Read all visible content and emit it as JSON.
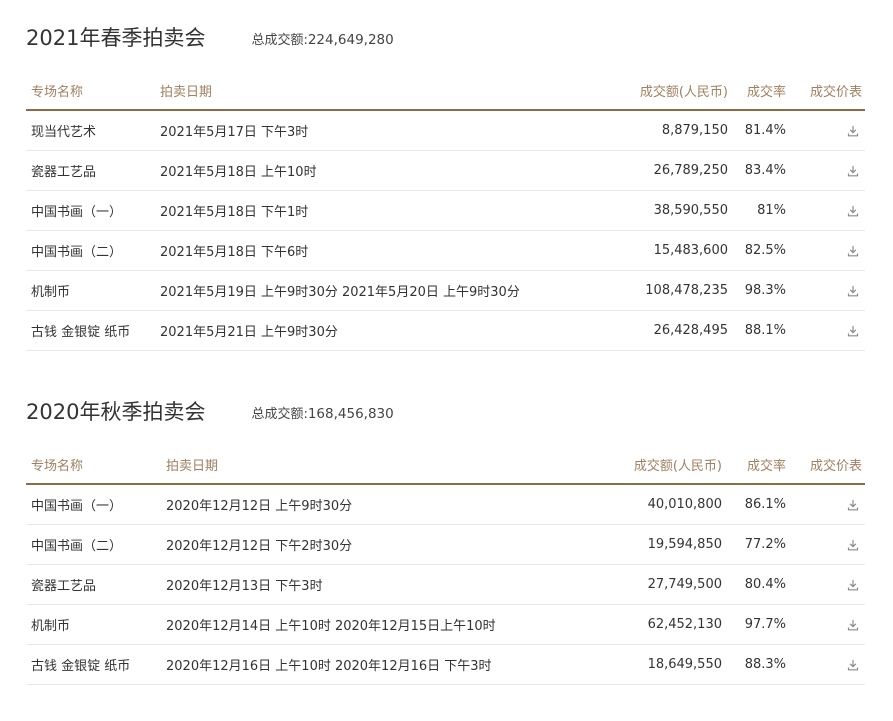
{
  "sections": [
    {
      "title": "2021年春季拍卖会",
      "total_label": "总成交额:",
      "total_value": "224,649,280",
      "headers": {
        "name": "专场名称",
        "date": "拍卖日期",
        "amount": "成交额(人民币)",
        "rate": "成交率",
        "price_list": "成交价表"
      },
      "rows": [
        {
          "name": "现当代艺术",
          "date": "2021年5月17日 下午3时",
          "amount": "8,879,150",
          "rate": "81.4%",
          "icon": "download-icon"
        },
        {
          "name": "瓷器工艺品",
          "date": "2021年5月18日 上午10时",
          "amount": "26,789,250",
          "rate": "83.4%",
          "icon": "download-icon"
        },
        {
          "name": "中国书画（一）",
          "date": "2021年5月18日 下午1时",
          "amount": "38,590,550",
          "rate": "81%",
          "icon": "download-icon"
        },
        {
          "name": "中国书画（二）",
          "date": "2021年5月18日 下午6时",
          "amount": "15,483,600",
          "rate": "82.5%",
          "icon": "download-icon"
        },
        {
          "name": "机制币",
          "date": "2021年5月19日 上午9时30分 2021年5月20日 上午9时30分",
          "amount": "108,478,235",
          "rate": "98.3%",
          "icon": "download-icon"
        },
        {
          "name": "古钱 金银锭 纸币",
          "date": "2021年5月21日 上午9时30分",
          "amount": "26,428,495",
          "rate": "88.1%",
          "icon": "download-icon"
        }
      ]
    },
    {
      "title": "2020年秋季拍卖会",
      "total_label": "总成交额:",
      "total_value": "168,456,830",
      "headers": {
        "name": "专场名称",
        "date": "拍卖日期",
        "amount": "成交额(人民币)",
        "rate": "成交率",
        "price_list": "成交价表"
      },
      "rows": [
        {
          "name": "中国书画（一）",
          "date": "2020年12月12日 上午9时30分",
          "amount": "40,010,800",
          "rate": "86.1%",
          "icon": "download-icon"
        },
        {
          "name": "中国书画（二）",
          "date": "2020年12月12日 下午2时30分",
          "amount": "19,594,850",
          "rate": "77.2%",
          "icon": "download-icon"
        },
        {
          "name": "瓷器工艺品",
          "date": "2020年12月13日 下午3时",
          "amount": "27,749,500",
          "rate": "80.4%",
          "icon": "download-icon"
        },
        {
          "name": "机制币",
          "date": "2020年12月14日 上午10时 2020年12月15日上午10时",
          "amount": "62,452,130",
          "rate": "97.7%",
          "icon": "download-icon"
        },
        {
          "name": "古钱 金银锭 纸币",
          "date": "2020年12月16日 上午10时 2020年12月16日 下午3时",
          "amount": "18,649,550",
          "rate": "88.3%",
          "icon": "download-icon"
        }
      ]
    }
  ],
  "colors": {
    "header_text": "#a08060",
    "header_rule": "#8a6d47",
    "row_rule": "#e8e8e8",
    "icon": "#8a8a8a"
  }
}
